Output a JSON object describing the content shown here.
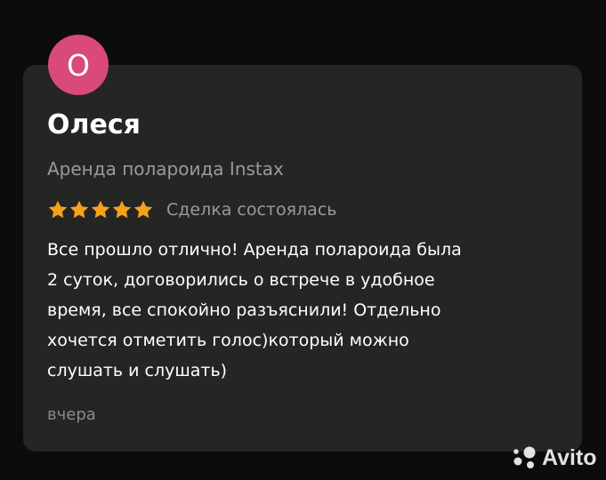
{
  "review": {
    "avatar_letter": "О",
    "avatar_color": "#d9497a",
    "author_name": "Олеся",
    "item_title": "Аренда полароида Instax",
    "rating": 5,
    "rating_max": 5,
    "star_color": "#f4a11c",
    "deal_status": "Сделка состоялась",
    "text_lines": [
      "Все прошло отлично! Аренда полароида была",
      "2 суток, договорились о встрече в удобное",
      "время, все спокойно разъяснили! Отдельно",
      "хочется отметить голос)который можно",
      "слушать и слушать)"
    ],
    "date": "вчера"
  },
  "watermark": {
    "brand": "Avito",
    "icon": "avito-logo-icon"
  }
}
